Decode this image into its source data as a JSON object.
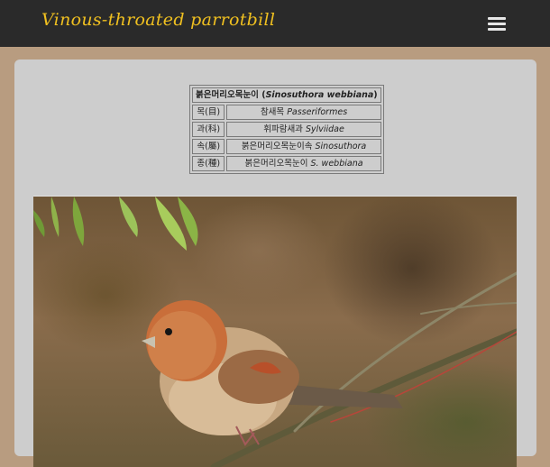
{
  "header": {
    "site_title": "Vinous-throated parrotbill",
    "menu_icon": "hamburger-menu-icon"
  },
  "taxonomy": {
    "title_korean": "붉은머리오목눈이 (",
    "title_latin": "Sinosuthora webbiana",
    "title_close": ")",
    "rows": [
      {
        "rank": "목(目)",
        "korean": "참새목 ",
        "latin": "Passeriformes"
      },
      {
        "rank": "과(科)",
        "korean": "휘파람새과 ",
        "latin": "Sylviidae"
      },
      {
        "rank": "속(屬)",
        "korean": "붉은머리오목눈이속 ",
        "latin": "Sinosuthora"
      },
      {
        "rank": "종(種)",
        "korean": "붉은머리오목눈이 ",
        "latin": "S. webbiana"
      }
    ]
  },
  "colors": {
    "page_background": "#b89c80",
    "header_background": "#2a2a2a",
    "title_color": "#f0c020",
    "card_background": "#cdcdcd"
  }
}
